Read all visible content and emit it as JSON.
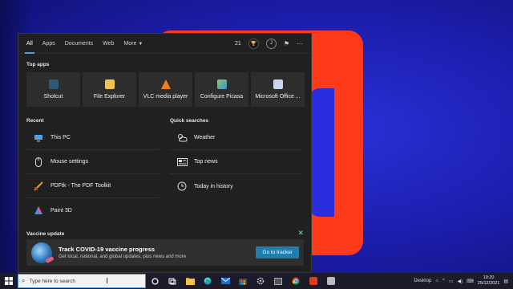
{
  "desktop": {
    "wallpaper_colors": [
      "#1c1fb0",
      "#ff3a1a"
    ]
  },
  "search_panel": {
    "tabs": [
      {
        "label": "All",
        "active": true
      },
      {
        "label": "Apps"
      },
      {
        "label": "Documents"
      },
      {
        "label": "Web"
      },
      {
        "label": "More"
      }
    ],
    "rewards_points": "21",
    "user_initial": "J",
    "top_apps_title": "Top apps",
    "top_apps": [
      {
        "label": "Shotcut",
        "icon": "shotcut-icon",
        "color": "#3a6b8a"
      },
      {
        "label": "File Explorer",
        "icon": "folder-icon",
        "color": "#f2c14e"
      },
      {
        "label": "VLC media player",
        "icon": "vlc-cone-icon",
        "color": "#f07c1a"
      },
      {
        "label": "Configure Picasa",
        "icon": "picasa-icon",
        "color": "#7fbf4f"
      },
      {
        "label": "Microsoft Office ...",
        "icon": "office-icon",
        "color": "#9fb7d8"
      }
    ],
    "recent_title": "Recent",
    "recent": [
      {
        "label": "This PC",
        "icon": "computer-icon"
      },
      {
        "label": "Mouse settings",
        "icon": "mouse-icon"
      },
      {
        "label": "PDFtk - The PDF Toolkit",
        "icon": "pdftk-icon"
      },
      {
        "label": "Paint 3D",
        "icon": "paint3d-icon"
      }
    ],
    "quick_title": "Quick searches",
    "quick": [
      {
        "label": "Weather",
        "icon": "weather-icon"
      },
      {
        "label": "Top news",
        "icon": "news-icon"
      },
      {
        "label": "Today in history",
        "icon": "clock-icon"
      }
    ],
    "vaccine": {
      "title": "Vaccine update",
      "headline": "Track COVID-19 vaccine progress",
      "subtext": "Get local, national, and global updates, plus news and more",
      "button": "Go to tracker"
    }
  },
  "taskbar": {
    "search_placeholder": "Type here to search",
    "tray_label": "Desktop",
    "time": "19:20",
    "date": "25/12/2021"
  }
}
